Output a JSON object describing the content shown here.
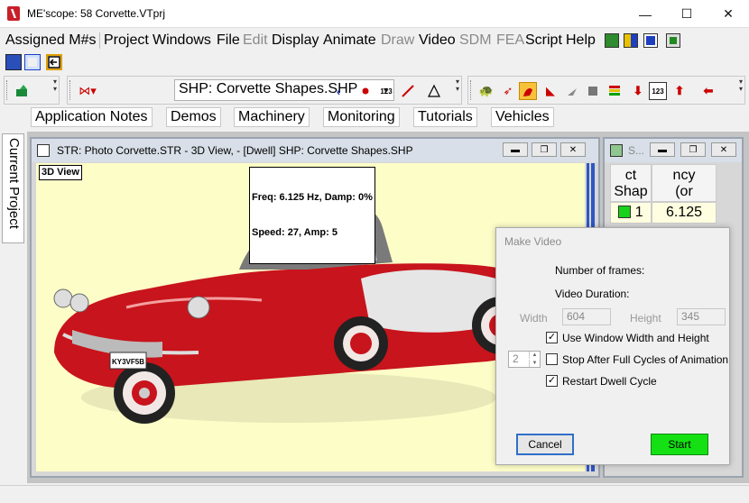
{
  "window": {
    "title": "ME'scope: 58 Corvette.VTprj",
    "minimize_glyph": "—",
    "maximize_glyph": "☐",
    "close_glyph": "✕"
  },
  "menu": {
    "items": [
      {
        "label": "Assigned M#s",
        "enabled": true
      },
      {
        "label": "Project",
        "enabled": true
      },
      {
        "label": "Windows",
        "enabled": true
      },
      {
        "label": "File",
        "enabled": true
      },
      {
        "label": "Edit",
        "enabled": false
      },
      {
        "label": "Display",
        "enabled": true
      },
      {
        "label": "Animate",
        "enabled": true
      },
      {
        "label": "Draw",
        "enabled": false
      },
      {
        "label": "Video",
        "enabled": true
      },
      {
        "label": "SDM",
        "enabled": false
      },
      {
        "label": "FEA",
        "enabled": false
      },
      {
        "label": "Script",
        "enabled": true
      },
      {
        "label": "Help",
        "enabled": true
      }
    ]
  },
  "shape_combo": {
    "value": "SHP: Corvette Shapes.SHP"
  },
  "links": [
    "Application Notes",
    "Demos",
    "Machinery",
    "Monitoring",
    "Tutorials",
    "Vehicles"
  ],
  "side_tab": {
    "label": "Current Project"
  },
  "view_window": {
    "title": "STR: Photo Corvette.STR - 3D View,  - [Dwell] SHP: Corvette Shapes.SHP",
    "view_label": "3D View",
    "info_line1": "Freq: 6.125 Hz, Damp: 0%",
    "info_line2": "Speed: 27, Amp: 5",
    "license_plate": "KY3VF5B"
  },
  "shapes_window": {
    "title": "S...",
    "col1_header": "ct\nShap",
    "col2_header": "ncy\n(or",
    "row1_index": "1",
    "row1_freq": "6.125"
  },
  "dialog": {
    "title": "Make Video",
    "frames_label": "Number of frames:",
    "duration_label": "Video Duration:",
    "width_label": "Width",
    "width_value": "604",
    "height_label": "Height",
    "height_value": "345",
    "chk_window_size": {
      "label": "Use Window Width and Height",
      "checked": true
    },
    "cycles_value": "2",
    "chk_stop_cycles": {
      "label": "Stop After Full Cycles of Animation",
      "checked": false
    },
    "chk_restart": {
      "label": "Restart Dwell Cycle",
      "checked": true
    },
    "cancel_label": "Cancel",
    "start_label": "Start"
  },
  "colors": {
    "viewport_bg": "#fdfdc8",
    "car_body": "#c8141c",
    "start_button": "#14e014",
    "active_row_swatch": "#19d219"
  }
}
